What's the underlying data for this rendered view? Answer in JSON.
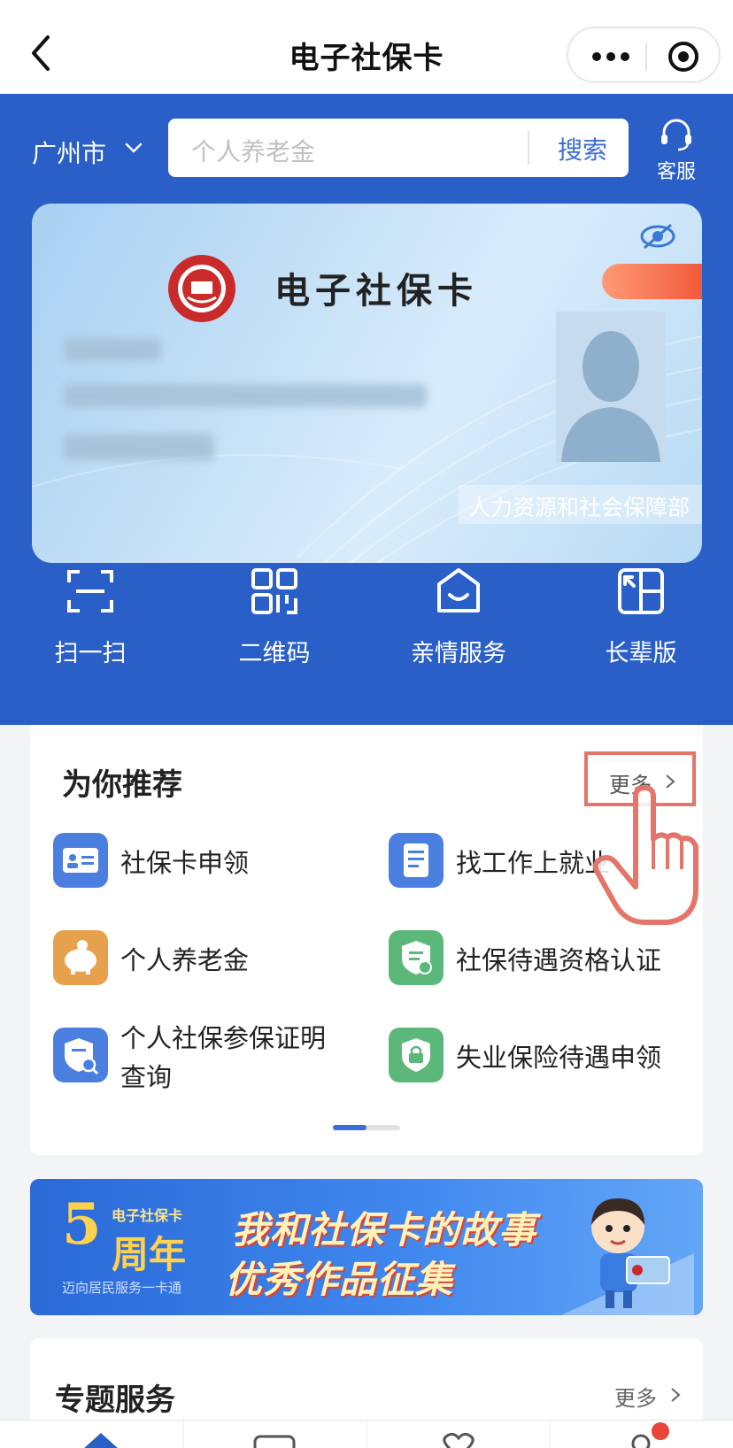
{
  "titlebar": {
    "title": "电子社保卡"
  },
  "header": {
    "city": "广州市",
    "search_placeholder": "个人养老金",
    "search_button": "搜索",
    "customer_service": "客服"
  },
  "card": {
    "title": "电子社保卡",
    "issuer": "人力资源和社会保障部"
  },
  "quick_actions": [
    {
      "label": "扫一扫",
      "icon": "scan-icon"
    },
    {
      "label": "二维码",
      "icon": "qrcode-icon"
    },
    {
      "label": "亲情服务",
      "icon": "family-service-icon"
    },
    {
      "label": "长辈版",
      "icon": "elder-mode-icon"
    }
  ],
  "recommend": {
    "title": "为你推荐",
    "more": "更多",
    "items": [
      {
        "label": "社保卡申领",
        "icon": "id-card-icon",
        "color": "#4a7fe0"
      },
      {
        "label": "找工作上就业",
        "icon": "document-icon",
        "color": "#4a7fe0"
      },
      {
        "label": "个人养老金",
        "icon": "piggy-bank-icon",
        "color": "#e7a04c"
      },
      {
        "label": "社保待遇资格认证",
        "icon": "shield-check-icon",
        "color": "#5cb87a"
      },
      {
        "label": "个人社保参保证明查询",
        "icon": "shield-search-icon",
        "color": "#4a7fe0"
      },
      {
        "label": "失业保险待遇申领",
        "icon": "shield-lock-icon",
        "color": "#5cb87a"
      }
    ]
  },
  "banner": {
    "brand": "电子社保卡",
    "number": "5",
    "anniversary": "周年",
    "slogan": "迈向居民服务一卡通",
    "line1": "我和社保卡的故事",
    "line2": "优秀作品征集"
  },
  "special": {
    "title": "专题服务",
    "more": "更多"
  },
  "colors": {
    "primary": "#2a5fc7",
    "accent": "#3a6ed6",
    "highlight": "#e3756a"
  }
}
